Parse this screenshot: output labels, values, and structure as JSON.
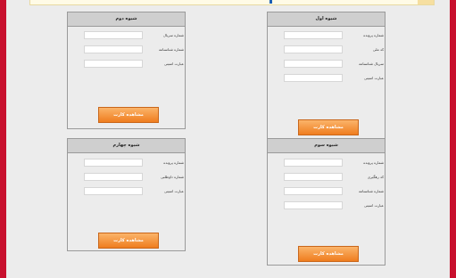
{
  "panels": [
    {
      "title": "شیوه اول",
      "fields": [
        {
          "label": "شماره پرونده",
          "value": ""
        },
        {
          "label": "کد ملی",
          "value": ""
        },
        {
          "label": "سریال شناسنامه",
          "value": ""
        },
        {
          "label": "عبارت امنیتی",
          "value": ""
        }
      ],
      "button": "مشاهده کارت"
    },
    {
      "title": "شیوه دوم",
      "fields": [
        {
          "label": "شماره سریال",
          "value": ""
        },
        {
          "label": "شماره شناسنامه",
          "value": ""
        },
        {
          "label": "عبارت امنیتی",
          "value": ""
        }
      ],
      "button": "مشاهده کارت"
    },
    {
      "title": "شیوه سوم",
      "fields": [
        {
          "label": "شماره پرونده",
          "value": ""
        },
        {
          "label": "کد رهگیری",
          "value": ""
        },
        {
          "label": "شماره شناسنامه",
          "value": ""
        },
        {
          "label": "عبارت امنیتی",
          "value": ""
        }
      ],
      "button": "مشاهده کارت"
    },
    {
      "title": "شیوه چهارم",
      "fields": [
        {
          "label": "شماره پرونده",
          "value": ""
        },
        {
          "label": "شماره داوطلبی",
          "value": ""
        },
        {
          "label": "عبارت امنیتی",
          "value": ""
        }
      ],
      "button": "مشاهده کارت"
    }
  ],
  "colors": {
    "frame": "#c8102e",
    "header": "#cfcfcf",
    "button_top": "#fbb46a",
    "button_bottom": "#ef7d1f"
  }
}
